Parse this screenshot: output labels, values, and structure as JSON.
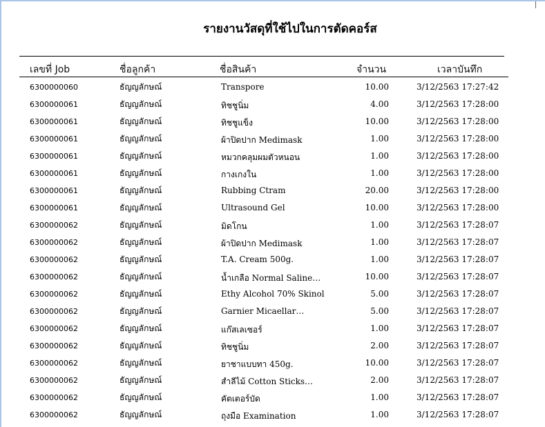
{
  "report": {
    "title": "รายงานวัสดุที่ใช้ไปในการตัดคอร์ส",
    "headers": {
      "job": "เลขที่ Job",
      "customer": "ชื่อลูกค้า",
      "product": "ชื่อสินค้า",
      "quantity": "จำนวน",
      "time": "เวลาบันทึก"
    },
    "rows": [
      {
        "job": "6300000060",
        "customer": "ธัญญลักษณ์",
        "product": "Transpore",
        "quantity": "10.00",
        "time": "3/12/2563 17:27:42"
      },
      {
        "job": "6300000061",
        "customer": "ธัญญลักษณ์",
        "product": "ทิชชูนิ่ม",
        "quantity": "4.00",
        "time": "3/12/2563 17:28:00"
      },
      {
        "job": "6300000061",
        "customer": "ธัญญลักษณ์",
        "product": "ทิชชูแข็ง",
        "quantity": "10.00",
        "time": "3/12/2563 17:28:00"
      },
      {
        "job": "6300000061",
        "customer": "ธัญญลักษณ์",
        "product": "ผ้าปิดปาก Medimask",
        "quantity": "1.00",
        "time": "3/12/2563 17:28:00"
      },
      {
        "job": "6300000061",
        "customer": "ธัญญลักษณ์",
        "product": "หมวกคลุมผมตัวหนอน",
        "quantity": "1.00",
        "time": "3/12/2563 17:28:00"
      },
      {
        "job": "6300000061",
        "customer": "ธัญญลักษณ์",
        "product": "กางเกงใน",
        "quantity": "1.00",
        "time": "3/12/2563 17:28:00"
      },
      {
        "job": "6300000061",
        "customer": "ธัญญลักษณ์",
        "product": "Rubbing Ctram",
        "quantity": "20.00",
        "time": "3/12/2563 17:28:00"
      },
      {
        "job": "6300000061",
        "customer": "ธัญญลักษณ์",
        "product": "Ultrasound Gel",
        "quantity": "10.00",
        "time": "3/12/2563 17:28:00"
      },
      {
        "job": "6300000062",
        "customer": "ธัญญลักษณ์",
        "product": "มิดโกน",
        "quantity": "1.00",
        "time": "3/12/2563 17:28:07"
      },
      {
        "job": "6300000062",
        "customer": "ธัญญลักษณ์",
        "product": "ผ้าปิดปาก Medimask",
        "quantity": "1.00",
        "time": "3/12/2563 17:28:07"
      },
      {
        "job": "6300000062",
        "customer": "ธัญญลักษณ์",
        "product": "T.A. Cream 500g.",
        "quantity": "1.00",
        "time": "3/12/2563 17:28:07"
      },
      {
        "job": "6300000062",
        "customer": "ธัญญลักษณ์",
        "product": "น้ำเกลือ Normal Saline…",
        "quantity": "10.00",
        "time": "3/12/2563 17:28:07"
      },
      {
        "job": "6300000062",
        "customer": "ธัญญลักษณ์",
        "product": "Ethy Alcohol 70% Skinol",
        "quantity": "5.00",
        "time": "3/12/2563 17:28:07"
      },
      {
        "job": "6300000062",
        "customer": "ธัญญลักษณ์",
        "product": "Garnier Micaellar…",
        "quantity": "5.00",
        "time": "3/12/2563 17:28:07"
      },
      {
        "job": "6300000062",
        "customer": "ธัญญลักษณ์",
        "product": "แก๊สเลเซอร์",
        "quantity": "1.00",
        "time": "3/12/2563 17:28:07"
      },
      {
        "job": "6300000062",
        "customer": "ธัญญลักษณ์",
        "product": "ทิชชูนิ่ม",
        "quantity": "2.00",
        "time": "3/12/2563 17:28:07"
      },
      {
        "job": "6300000062",
        "customer": "ธัญญลักษณ์",
        "product": "ยาชาแบบทา 450g.",
        "quantity": "10.00",
        "time": "3/12/2563 17:28:07"
      },
      {
        "job": "6300000062",
        "customer": "ธัญญลักษณ์",
        "product": "สำลีไม้ Cotton Sticks…",
        "quantity": "2.00",
        "time": "3/12/2563 17:28:07"
      },
      {
        "job": "6300000062",
        "customer": "ธัญญลักษณ์",
        "product": "คัตเตอร์บัด",
        "quantity": "1.00",
        "time": "3/12/2563 17:28:07"
      },
      {
        "job": "6300000062",
        "customer": "ธัญญลักษณ์",
        "product": "ถุงมือ Examination",
        "quantity": "1.00",
        "time": "3/12/2563 17:28:07"
      }
    ]
  }
}
